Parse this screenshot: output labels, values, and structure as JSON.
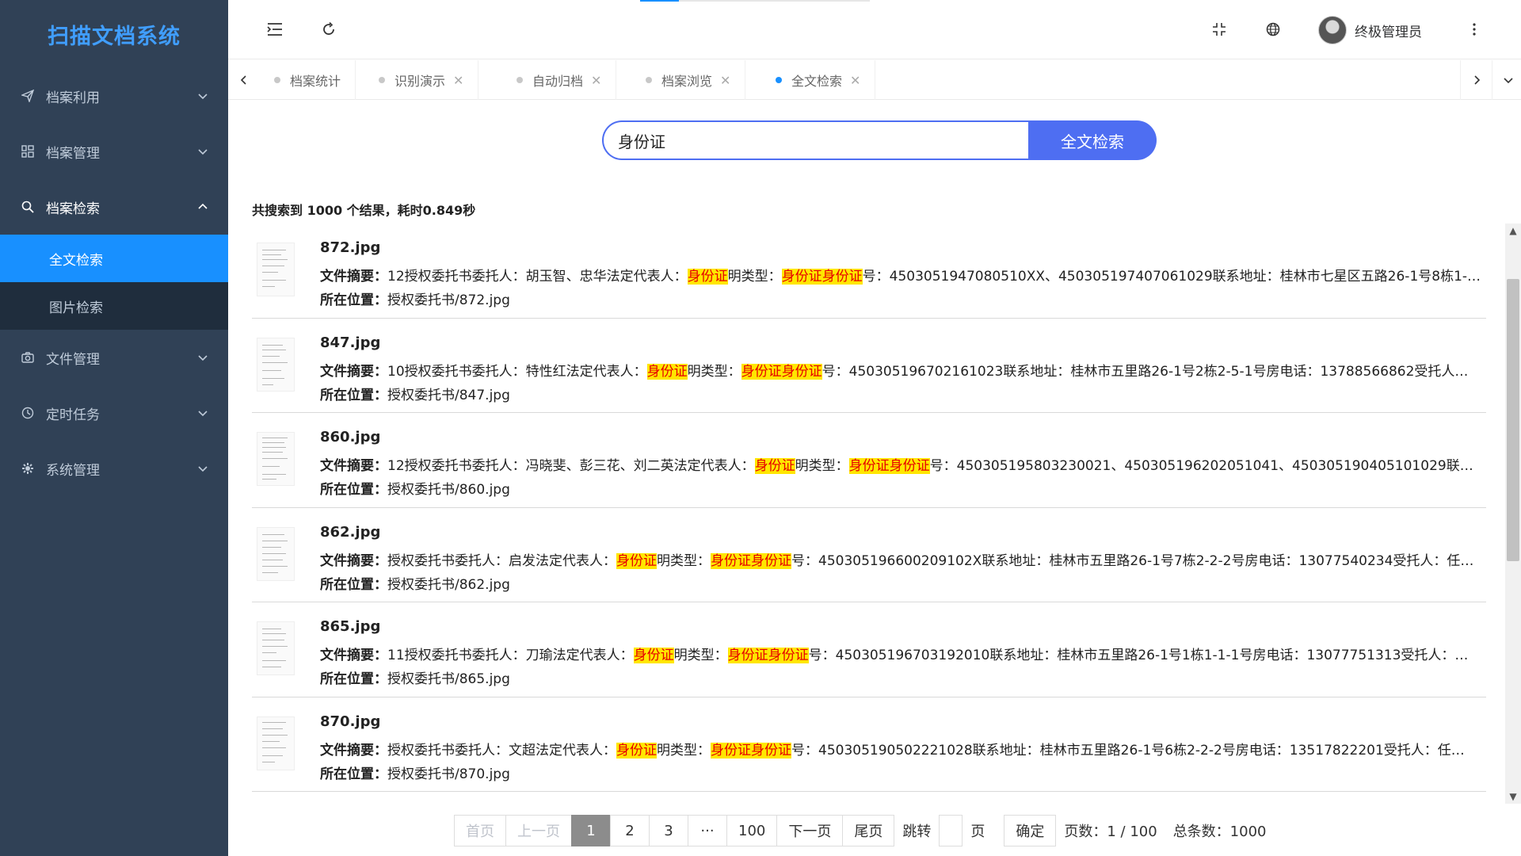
{
  "app": {
    "title": "扫描文档系统"
  },
  "sidebar": {
    "items": [
      {
        "label": "档案利用",
        "icon": "paper-plane-icon"
      },
      {
        "label": "档案管理",
        "icon": "grid-icon"
      },
      {
        "label": "档案检索",
        "icon": "search-icon",
        "expanded": true,
        "children": [
          {
            "label": "全文检索",
            "active": true
          },
          {
            "label": "图片检索"
          }
        ]
      },
      {
        "label": "文件管理",
        "icon": "camera-icon"
      },
      {
        "label": "定时任务",
        "icon": "clock-icon"
      },
      {
        "label": "系统管理",
        "icon": "gear-icon"
      }
    ]
  },
  "header": {
    "username": "终极管理员"
  },
  "tags": [
    {
      "label": "档案统计",
      "closable": false
    },
    {
      "label": "识别演示",
      "closable": true
    },
    {
      "label": "自动归档",
      "closable": true
    },
    {
      "label": "档案浏览",
      "closable": true
    },
    {
      "label": "全文检索",
      "closable": true,
      "active": true
    }
  ],
  "search": {
    "query": "身份证",
    "button_label": "全文检索"
  },
  "summary": "共搜索到 1000 个结果，耗时0.849秒",
  "labels": {
    "abstract": "文件摘要：",
    "location": "所在位置："
  },
  "results": [
    {
      "title": "872.jpg",
      "abstract_prefix": "12授权委托书委托人：胡玉智、忠华法定代表人：",
      "hl1": "身份证",
      "mid": "明类型：",
      "hl2": "身份证身份证",
      "abstract_suffix": "号：4503051947080510XX、450305197407061029联系地址：桂林市七星区五路26-1号8栋1-…",
      "location": "授权委托书/872.jpg"
    },
    {
      "title": "847.jpg",
      "abstract_prefix": "10授权委托书委托人：特性红法定代表人：",
      "hl1": "身份证",
      "mid": "明类型：",
      "hl2": "身份证身份证",
      "abstract_suffix": "号：450305196702161023联系地址：桂林市五里路26-1号2栋2-5-1号房电话：13788566862受托人…",
      "location": "授权委托书/847.jpg"
    },
    {
      "title": "860.jpg",
      "abstract_prefix": "12授权委托书委托人：冯晓斐、彭三花、刘二英法定代表人：",
      "hl1": "身份证",
      "mid": "明类型：",
      "hl2": "身份证身份证",
      "abstract_suffix": "号：450305195803230021、450305196202051041、450305190405101029联系…",
      "location": "授权委托书/860.jpg"
    },
    {
      "title": "862.jpg",
      "abstract_prefix": "授权委托书委托人：启发法定代表人：",
      "hl1": "身份证",
      "mid": "明类型：",
      "hl2": "身份证身份证",
      "abstract_suffix": "号：450305196600209102X联系地址：桂林市五里路26-1号7栋2-2-2号房电话：13077540234受托人：任…",
      "location": "授权委托书/862.jpg"
    },
    {
      "title": "865.jpg",
      "abstract_prefix": "11授权委托书委托人：刀瑜法定代表人：",
      "hl1": "身份证",
      "mid": "明类型：",
      "hl2": "身份证身份证",
      "abstract_suffix": "号：450305196703192010联系地址：桂林市五里路26-1号1栋1-1-1号房电话：13077751313受托人：…",
      "location": "授权委托书/865.jpg"
    },
    {
      "title": "870.jpg",
      "abstract_prefix": "授权委托书委托人：文超法定代表人：",
      "hl1": "身份证",
      "mid": "明类型：",
      "hl2": "身份证身份证",
      "abstract_suffix": "号：450305190502221028联系地址：桂林市五里路26-1号6栋2-2-2号房电话：13517822201受托人：任…",
      "location": "授权委托书/870.jpg"
    }
  ],
  "pagination": {
    "first": "首页",
    "prev": "上一页",
    "pages": [
      "1",
      "2",
      "3"
    ],
    "ellipsis": "···",
    "last_page": "100",
    "next": "下一页",
    "last": "尾页",
    "jump_label": "跳转",
    "page_unit": "页",
    "confirm": "确定",
    "page_info": "页数：1 / 100",
    "total_info": "总条数：1000",
    "current_page": 1
  },
  "top_progress": 0.17
}
